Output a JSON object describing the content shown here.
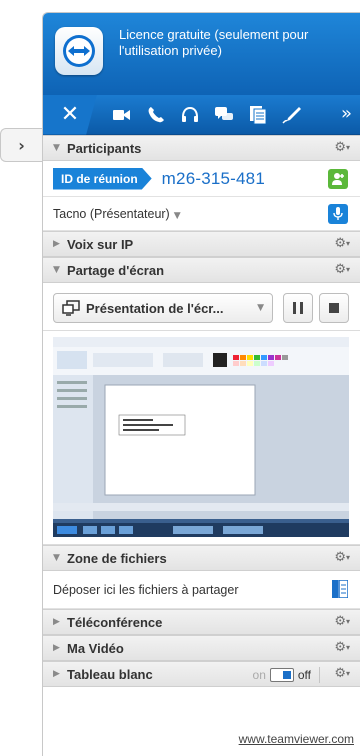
{
  "header": {
    "license": "Licence gratuite (seulement pour l'utilisation privée)"
  },
  "toolbar": {
    "close_label": "✕",
    "more_label": "»",
    "icons": [
      "camera-icon",
      "phone-icon",
      "headset-icon",
      "chat-icon",
      "files-icon",
      "pen-icon"
    ]
  },
  "sections": {
    "participants": "Participants",
    "voip": "Voix sur IP",
    "screen_share": "Partage d'écran",
    "files": "Zone de fichiers",
    "conference": "Téléconférence",
    "video": "Ma Vidéo",
    "whiteboard": "Tableau blanc"
  },
  "participants": {
    "meeting_label": "ID de réunion",
    "meeting_id": "m26-315-481",
    "presenter": "Tacno (Présentateur)"
  },
  "share": {
    "selected": "Présentation de l'écr..."
  },
  "files": {
    "drop_text": "Déposer ici les fichiers à partager"
  },
  "whiteboard": {
    "on": "on",
    "off": "off"
  },
  "footer": {
    "link": "www.teamviewer.com"
  },
  "colors": {
    "brand": "#1a83d9",
    "header_dark": "#0e63b5",
    "accent_green": "#5bb83a"
  }
}
